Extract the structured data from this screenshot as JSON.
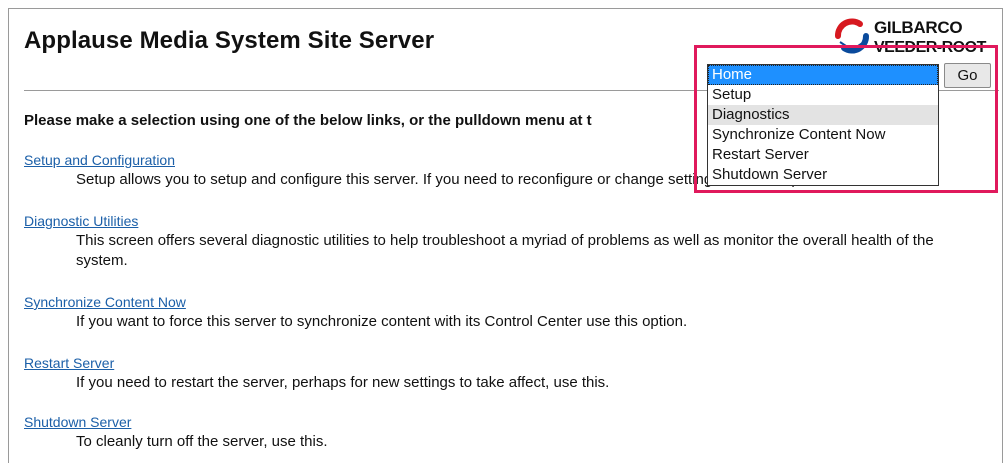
{
  "header": {
    "title": "Applause Media System Site Server",
    "logo_line1": "GILBARCO",
    "logo_line2": "VEEDER-ROOT"
  },
  "intro_text": "Please make a selection using one of the below links, or the pulldown menu at t",
  "links": [
    {
      "label": "Setup and Configuration",
      "description": "Setup allows you to setup and configure this server. If you need to reconfigure or change settings this is the place."
    },
    {
      "label": "Diagnostic Utilities",
      "description": "This screen offers several diagnostic utilities to help troubleshoot a myriad of problems as well as monitor the overall health of the system."
    },
    {
      "label": "Synchronize Content Now",
      "description": "If you want to force this server to synchronize content with its Control Center use this option."
    },
    {
      "label": "Restart Server",
      "description": "If you need to restart the server, perhaps for new settings to take affect, use this."
    },
    {
      "label": "Shutdown Server",
      "description": "To cleanly turn off the server, use this."
    }
  ],
  "nav_select": {
    "selected": "Home",
    "options": [
      "Home",
      "Setup",
      "Diagnostics",
      "Synchronize Content Now",
      "Restart Server",
      "Shutdown Server"
    ],
    "hovered": "Diagnostics",
    "go_label": "Go"
  },
  "colors": {
    "link": "#1b5fa8",
    "highlight_border": "#e0195c",
    "selected_option": "#1e90ff",
    "logo_red": "#d71920",
    "logo_blue": "#0a4a9c"
  },
  "icons": {
    "logo": "gilbarco-logo-icon"
  }
}
